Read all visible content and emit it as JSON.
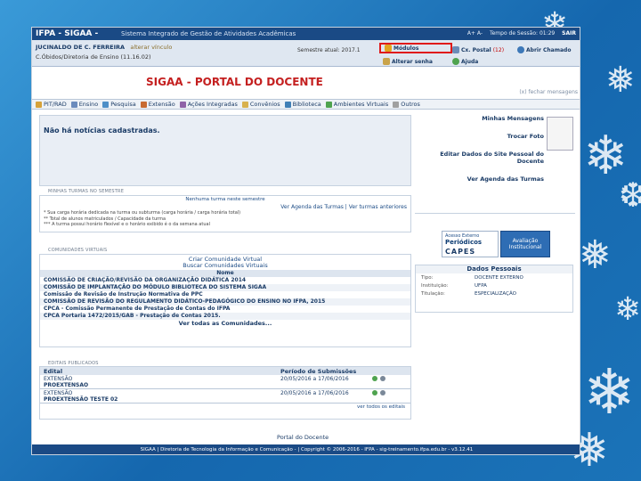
{
  "header": {
    "title": "IFPA - SIGAA -",
    "subtitle": "Sistema Integrado de Gestão de Atividades Acadêmicas",
    "font_size_label": "A+ A-",
    "session_time": "Tempo de Sessão: 01:29",
    "logout": "SAIR"
  },
  "user": {
    "name": "JUCINALDO DE C. FERREIRA",
    "change_link": "alterar vínculo",
    "unit": "C.Óbidos/Diretoria de Ensino (11.16.02)",
    "semester": "Semestre atual: 2017.1"
  },
  "toolbar": {
    "modulos": "Módulos",
    "caixa_postal": "Cx. Postal",
    "caixa_count": "(12)",
    "abrir_chamado": "Abrir Chamado",
    "alterar_senha": "Alterar senha",
    "ajuda": "Ajuda"
  },
  "page_title": "SIGAA - PORTAL DO DOCENTE",
  "close_messages": "(x) fechar mensagens",
  "menu": [
    "PIT/RAD",
    "Ensino",
    "Pesquisa",
    "Extensão",
    "Ações Integradas",
    "Convênios",
    "Biblioteca",
    "Ambientes Virtuais",
    "Outros"
  ],
  "news": "Não há notícias cadastradas.",
  "turmas": {
    "section": "MINHAS TURMAS NO SEMESTRE",
    "title": "Nenhuma turma neste semestre",
    "agenda": "Ver Agenda das Turmas",
    "anteriores": "Ver turmas anteriores",
    "note1": "* Sua carga horária dedicada na turma ou subturma (carga horária / carga horária total)",
    "note2": "** Total de alunos matriculados / Capacidade da turma",
    "note3": "*** A turma possui horário flexível e o horário exibido é o da semana atual"
  },
  "comunidades": {
    "section": "COMUNIDADES VIRTUAIS",
    "criar": "Criar Comunidade Virtual",
    "buscar": "Buscar Comunidades Virtuais",
    "col": "Nome",
    "items": [
      "COMISSÃO DE CRIAÇÃO/REVISÃO DA ORGANIZAÇÃO DIDÁTICA 2014",
      "COMISSÃO DE IMPLANTAÇÃO DO MÓDULO BIBLIOTECA DO SISTEMA SIGAA",
      "Comissão de Revisão de Instrução Normativa de PPC",
      "COMISSÃO DE REVISÃO DO REGULAMENTO DIDÁTICO-PEDAGÓGICO DO ENSINO NO IFPA, 2015",
      "CPCA - Comissão Permanente de Prestação de Contas do IFPA",
      "CPCA Portaria 1472/2015/GAB - Prestação de Contas 2015."
    ],
    "todas": "Ver todas as Comunidades..."
  },
  "editais": {
    "section": "EDITAIS PUBLICADOS",
    "col1": "Edital",
    "col2": "Período de Submissões",
    "rows": [
      {
        "name": "EXTENSÃO",
        "period": "20/05/2016 a 17/06/2016",
        "sub": "PROEXTENSAO"
      },
      {
        "name": "EXTENSÃO",
        "period": "20/05/2016 a 17/06/2016",
        "sub": "PROEXTENSÃO TESTE 02"
      }
    ],
    "more": "ver todos os editais"
  },
  "portal_link": "Portal do Docente",
  "footer": "SIGAA | Diretoria de Tecnologia da Informação e Comunicação - | Copyright © 2006-2016 - IFPA - sig-treinamento.ifpa.edu.br - v3.12.41",
  "right": {
    "links": [
      "Minhas Mensagens",
      "Trocar Foto",
      "Editar Dados do Site Pessoal do Docente",
      "Ver Agenda das Turmas"
    ],
    "capes_t1": "Acesso Externo",
    "capes_t2": "Periódicos",
    "capes_t3": "CAPES",
    "aval": "Avaliação Institucional",
    "dados_title": "Dados Pessoais",
    "dados": [
      {
        "k": "Tipo:",
        "v": "DOCENTE EXTERNO"
      },
      {
        "k": "Instituição:",
        "v": "UFPA"
      },
      {
        "k": "Titulação:",
        "v": "ESPECIALIZAÇÃO"
      }
    ]
  },
  "colors": {
    "header": "#1a4a85",
    "title_red": "#c41f1f",
    "highlight": "#e01a1a"
  }
}
